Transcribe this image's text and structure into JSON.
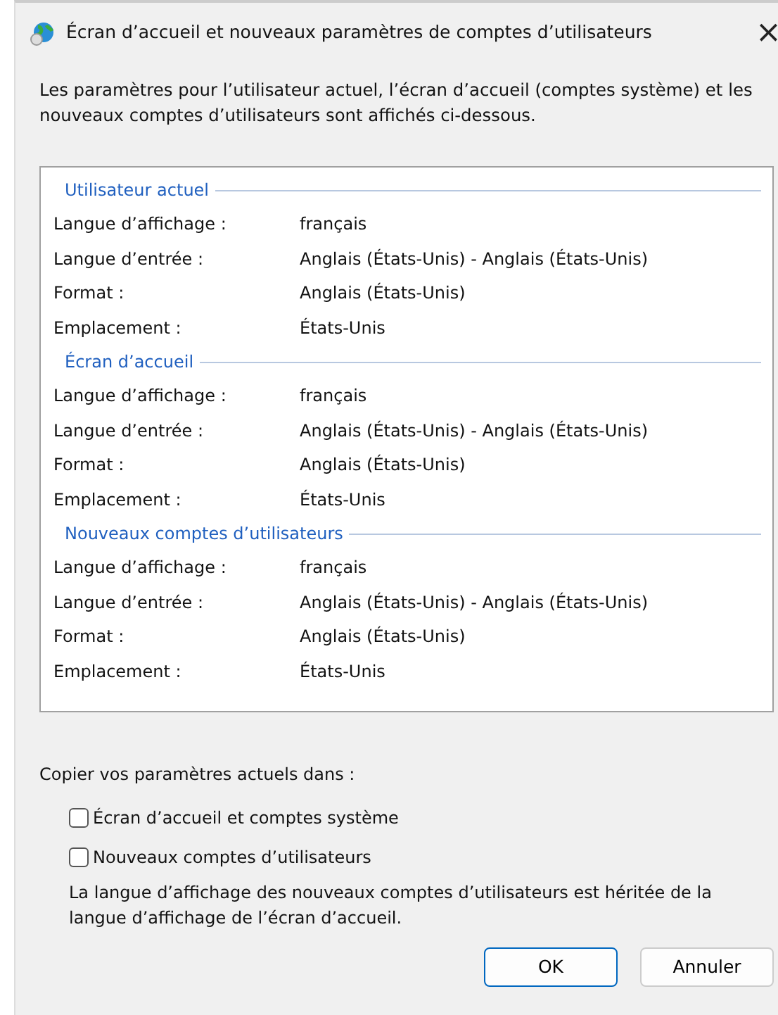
{
  "window": {
    "title": "Écran d’accueil et nouveaux paramètres de comptes d’utilisateurs",
    "close": "×"
  },
  "intro": "Les paramètres pour l’utilisateur actuel, l’écran d’accueil (comptes système) et les nouveaux comptes d’utilisateurs sont affichés ci-dessous.",
  "sections": [
    {
      "title": "Utilisateur actuel",
      "rows": [
        {
          "label": "Langue d’affichage :",
          "value": "français"
        },
        {
          "label": "Langue d’entrée :",
          "value": "Anglais (États-Unis) - Anglais (États-Unis)"
        },
        {
          "label": "Format :",
          "value": "Anglais (États-Unis)"
        },
        {
          "label": "Emplacement :",
          "value": "États-Unis"
        }
      ]
    },
    {
      "title": "Écran d’accueil",
      "rows": [
        {
          "label": "Langue d’affichage :",
          "value": "français"
        },
        {
          "label": "Langue d’entrée :",
          "value": "Anglais (États-Unis) - Anglais (États-Unis)"
        },
        {
          "label": "Format :",
          "value": "Anglais (États-Unis)"
        },
        {
          "label": "Emplacement :",
          "value": "États-Unis"
        }
      ]
    },
    {
      "title": "Nouveaux comptes d’utilisateurs",
      "rows": [
        {
          "label": "Langue d’affichage :",
          "value": "français"
        },
        {
          "label": "Langue d’entrée :",
          "value": "Anglais (États-Unis) - Anglais (États-Unis)"
        },
        {
          "label": "Format :",
          "value": "Anglais (États-Unis)"
        },
        {
          "label": "Emplacement :",
          "value": "États-Unis"
        }
      ]
    }
  ],
  "copy_label": "Copier vos paramètres actuels dans :",
  "options": [
    {
      "label": "Écran d’accueil et comptes système",
      "checked": false
    },
    {
      "label": "Nouveaux comptes d’utilisateurs",
      "checked": false
    }
  ],
  "note": "La langue d’affichage des nouveaux comptes d’utilisateurs est héritée de la langue d’affichage de l’écran d’accueil.",
  "buttons": [
    {
      "label": "OK",
      "default": true
    },
    {
      "label": "Annuler",
      "default": false
    }
  ]
}
